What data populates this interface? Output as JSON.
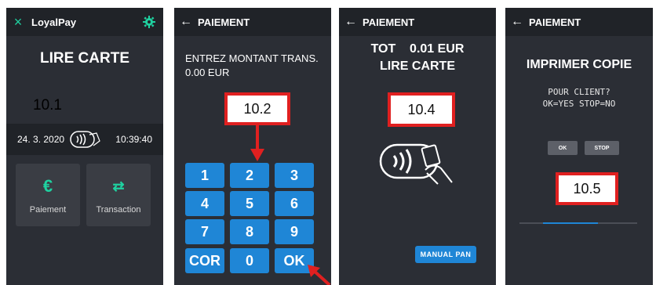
{
  "screen1": {
    "close_icon": "×",
    "app_title": "LoyalPay",
    "gear_icon": "gear",
    "heading": "LIRE CARTE",
    "annotation": "10.1",
    "date": "24. 3. 2020",
    "time": "10:39:40",
    "tiles": [
      {
        "icon": "€",
        "label": "Paiement"
      },
      {
        "icon": "⇄",
        "label": "Transaction"
      }
    ]
  },
  "screen2": {
    "back_icon": "←",
    "title": "PAIEMENT",
    "prompt_line1": "ENTREZ MONTANT TRANS.",
    "prompt_line2": "0.00 EUR",
    "annotation": "10.2",
    "keys": [
      "1",
      "2",
      "3",
      "4",
      "5",
      "6",
      "7",
      "8",
      "9",
      "COR",
      "0",
      "OK"
    ]
  },
  "screen3": {
    "back_icon": "←",
    "title": "PAIEMENT",
    "total_line": "TOT    0.01 EUR",
    "read_line": "LIRE CARTE",
    "annotation": "10.4",
    "manual_pan": "MANUAL PAN"
  },
  "screen4": {
    "back_icon": "←",
    "title": "PAIEMENT",
    "heading": "IMPRIMER COPIE",
    "line1": "POUR CLIENT?",
    "line2": "OK=YES STOP=NO",
    "ok_label": "OK",
    "stop_label": "STOP",
    "annotation": "10.5"
  },
  "colors": {
    "screen_bg": "#2b2e35",
    "topbar_bg": "#202328",
    "accent_teal": "#1fd1a0",
    "key_blue": "#1f86d6",
    "callout_red": "#e02020"
  }
}
